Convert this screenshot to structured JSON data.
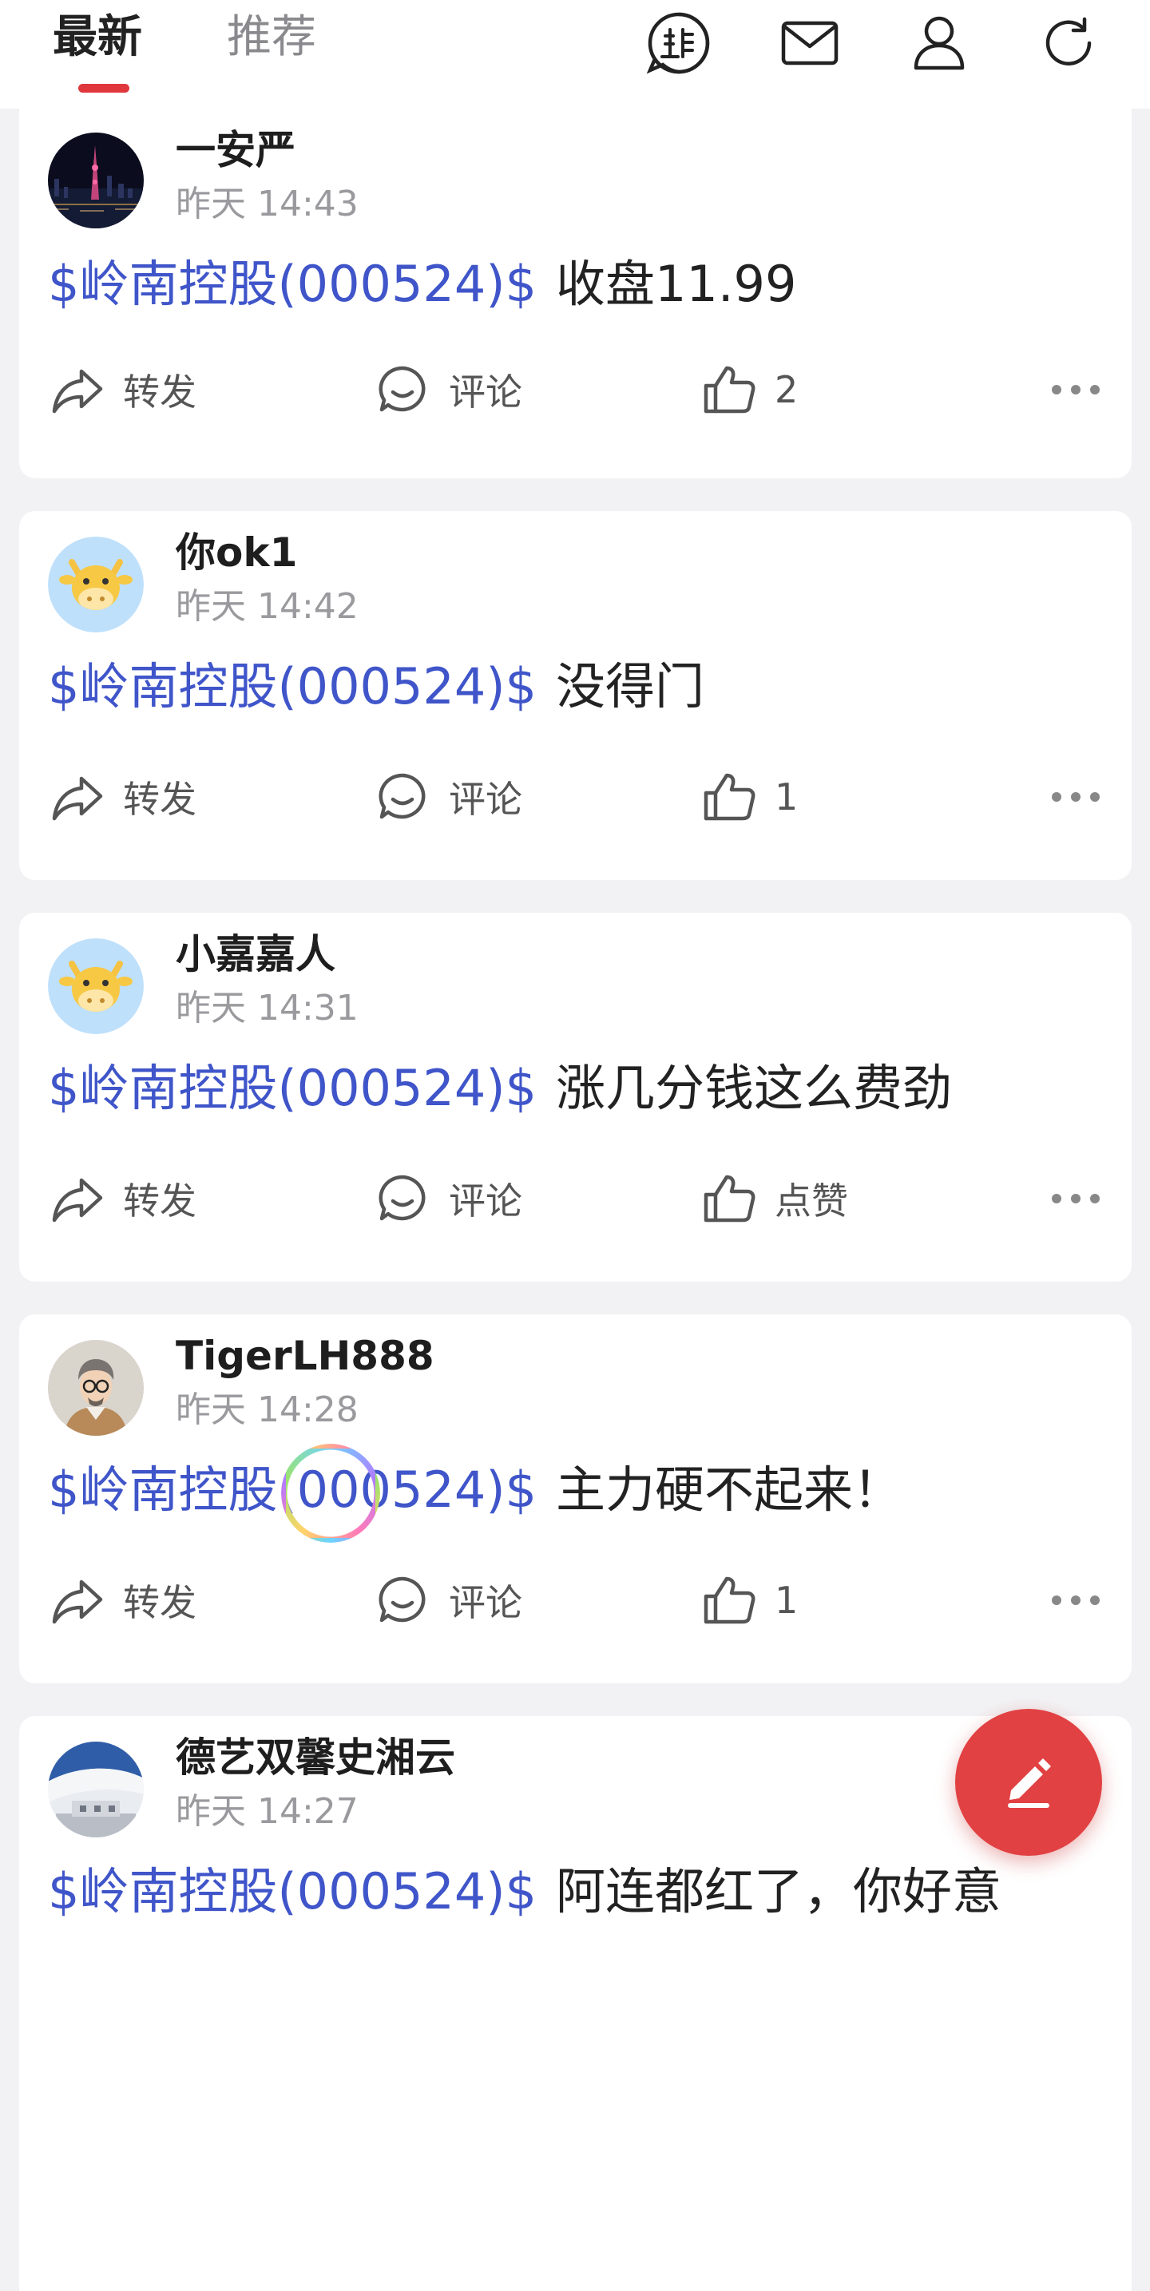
{
  "header": {
    "tabs": [
      {
        "label": "最新",
        "active": true
      },
      {
        "label": "推荐",
        "active": false
      }
    ],
    "icons": [
      "jiu-logo-icon",
      "mail-icon",
      "user-icon",
      "refresh-icon"
    ],
    "accent_color": "#e0373d"
  },
  "posts": [
    {
      "username": "一安严",
      "time": "昨天 14:43",
      "stock": "$岭南控股(000524)$",
      "text": "收盘11.99",
      "forward_label": "转发",
      "comment_label": "评论",
      "like_label": "2",
      "avatar": "city-night-photo"
    },
    {
      "username": "你ok1",
      "time": "昨天 14:42",
      "stock": "$岭南控股(000524)$",
      "text": "没得门",
      "forward_label": "转发",
      "comment_label": "评论",
      "like_label": "1",
      "avatar": "cow-cartoon"
    },
    {
      "username": "小嘉嘉人",
      "time": "昨天 14:31",
      "stock": "$岭南控股(000524)$",
      "text": "涨几分钱这么费劲",
      "forward_label": "转发",
      "comment_label": "评论",
      "like_label": "点赞",
      "avatar": "cow-cartoon"
    },
    {
      "username": "TigerLH888",
      "time": "昨天 14:28",
      "stock": "$岭南控股(000524)$",
      "text": "主力硬不起来！",
      "forward_label": "转发",
      "comment_label": "评论",
      "like_label": "1",
      "avatar": "man-glasses-illustration"
    },
    {
      "username": "德艺双馨史湘云",
      "time": "昨天 14:27",
      "stock": "$岭南控股(000524)$",
      "text": "阿连都红了，你好意",
      "avatar": "architecture-photo"
    }
  ],
  "colors": {
    "stock_tag": "#3f55c9",
    "fab": "#e14142"
  }
}
